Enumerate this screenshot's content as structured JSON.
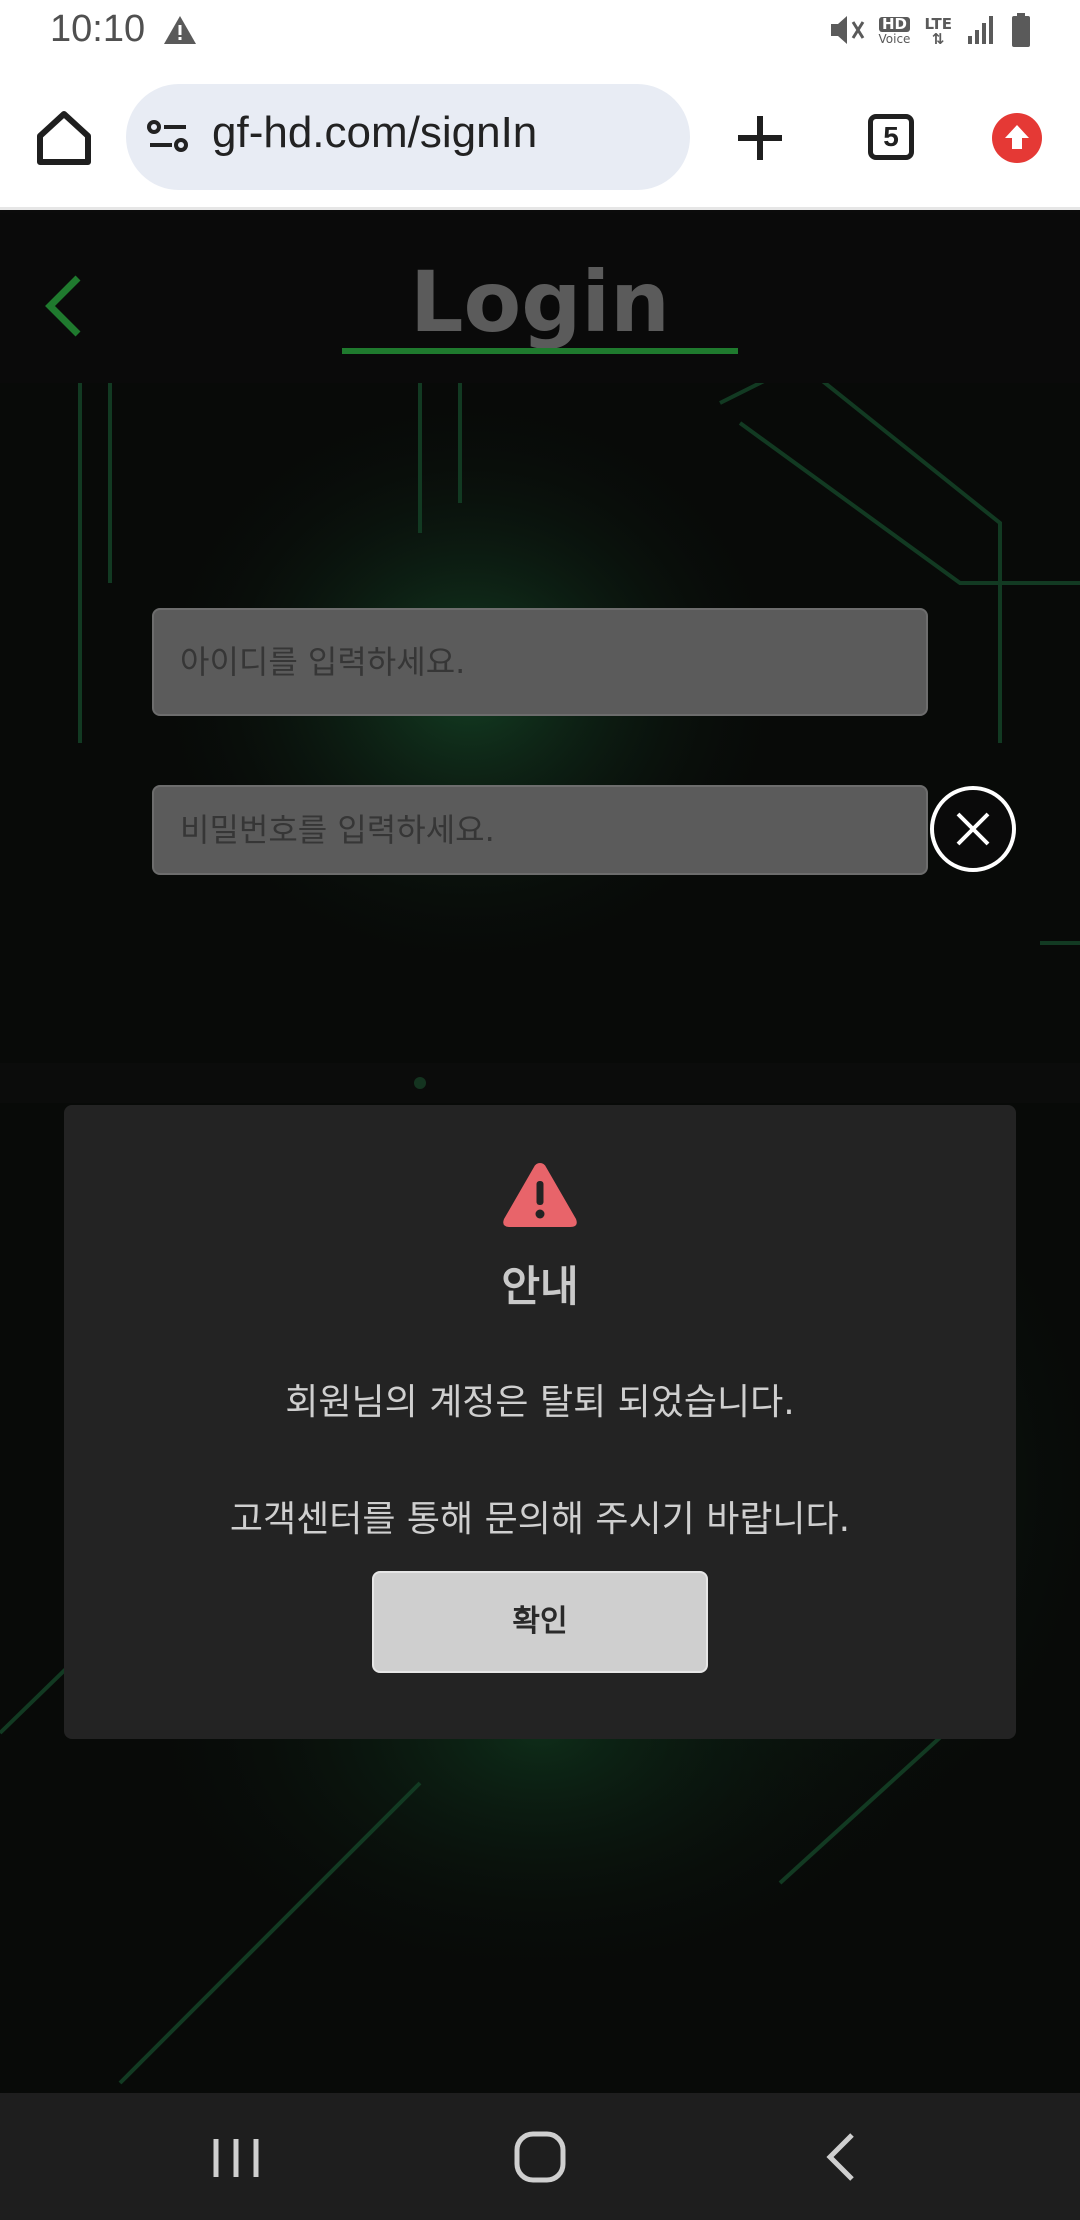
{
  "status_bar": {
    "time": "10:10",
    "hd_label": "HD",
    "voice_label": "Voice",
    "lte_label": "LTE"
  },
  "browser": {
    "url": "gf-hd.com/signIn",
    "tab_count": "5"
  },
  "page": {
    "title": "Login",
    "id_placeholder": "아이디를 입력하세요.",
    "password_placeholder": "비밀번호를 입력하세요."
  },
  "dialog": {
    "title": "안내",
    "message_line1": "회원님의 계정은 탈퇴 되었습니다.",
    "message_line2": "고객센터를 통해 문의해 주시기 바랍니다.",
    "confirm_label": "확인"
  },
  "colors": {
    "accent_green": "#1f7a2e",
    "warning_red": "#e8646a",
    "update_red": "#e53935"
  }
}
